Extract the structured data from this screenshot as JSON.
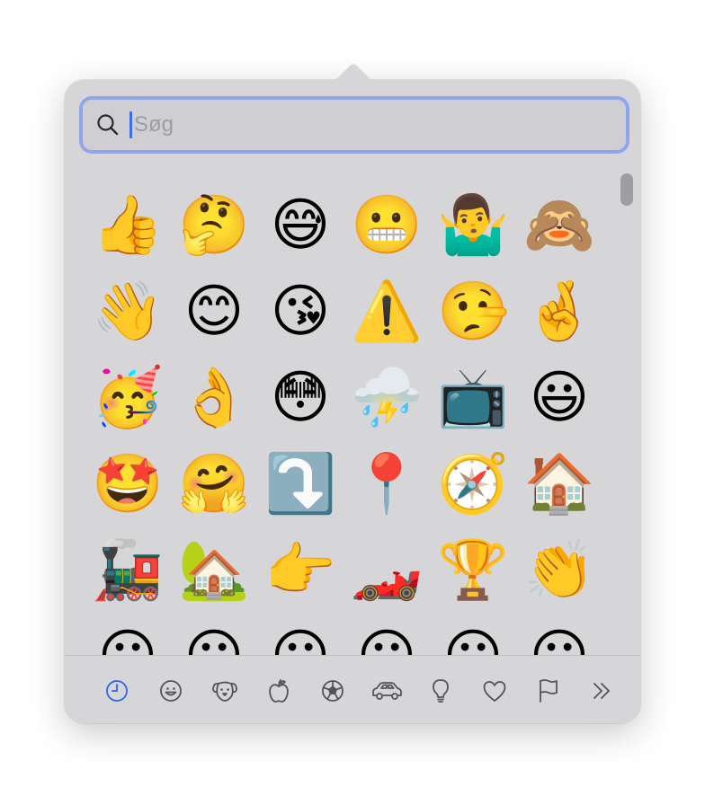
{
  "search": {
    "placeholder": "Søg",
    "value": ""
  },
  "emojis": [
    "👍",
    "🤔",
    "😅",
    "😬",
    "🤷‍♂️",
    "🙈",
    "👋",
    "😊",
    "😘",
    "⚠️",
    "🤥",
    "🤞",
    "🥳",
    "👌",
    "😳",
    "⛈️",
    "📺",
    "😃",
    "🤩",
    "🤗",
    "⤵️",
    "📍",
    "🧭",
    "🏠",
    "🚂",
    "🏡",
    "👉",
    "🏎️",
    "🏆",
    "👏",
    "😀",
    "😀",
    "😀",
    "😀",
    "😀",
    "😀"
  ],
  "tabs": [
    {
      "name": "recent",
      "icon": "clock-icon",
      "active": true
    },
    {
      "name": "smileys",
      "icon": "smiley-icon",
      "active": false
    },
    {
      "name": "animals",
      "icon": "dog-icon",
      "active": false
    },
    {
      "name": "food",
      "icon": "apple-icon",
      "active": false
    },
    {
      "name": "activity",
      "icon": "soccer-ball-icon",
      "active": false
    },
    {
      "name": "travel",
      "icon": "car-icon",
      "active": false
    },
    {
      "name": "objects",
      "icon": "lightbulb-icon",
      "active": false
    },
    {
      "name": "symbols",
      "icon": "heart-icon",
      "active": false
    },
    {
      "name": "flags",
      "icon": "flag-icon",
      "active": false
    },
    {
      "name": "more",
      "icon": "double-chevron-right-icon",
      "active": false
    }
  ],
  "colors": {
    "active_tab": "#2e62e8",
    "inactive_tab": "#555559",
    "focus_ring": "#8fa6ec"
  }
}
